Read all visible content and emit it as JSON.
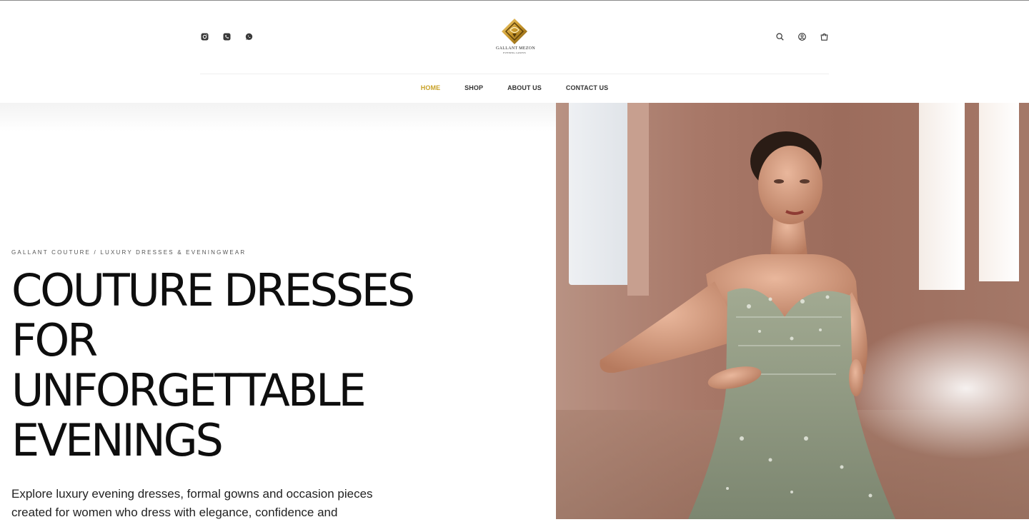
{
  "brand": {
    "logo_name": "GALLANT MEZON",
    "logo_sub": "EVENING GOWNS",
    "accent_color": "#c9a227"
  },
  "header": {
    "social_icons": [
      "instagram-icon",
      "phone-icon",
      "whatsapp-icon"
    ],
    "tool_icons": [
      "search-icon",
      "account-icon",
      "cart-icon"
    ]
  },
  "nav": {
    "items": [
      {
        "label": "HOME",
        "active": true
      },
      {
        "label": "SHOP",
        "active": false
      },
      {
        "label": "ABOUT US",
        "active": false
      },
      {
        "label": "CONTACT US",
        "active": false
      }
    ]
  },
  "hero": {
    "eyebrow": "GALLANT COUTURE / LUXURY DRESSES & EVENINGWEAR",
    "headline_lines": [
      "COUTURE DRESSES",
      "FOR",
      "UNFORGETTABLE",
      "EVENINGS"
    ],
    "intro": "Explore luxury evening dresses, formal gowns and occasion pieces created for women who dress with elegance, confidence and",
    "image_subject": "model-in-sage-embellished-strapless-gown"
  }
}
